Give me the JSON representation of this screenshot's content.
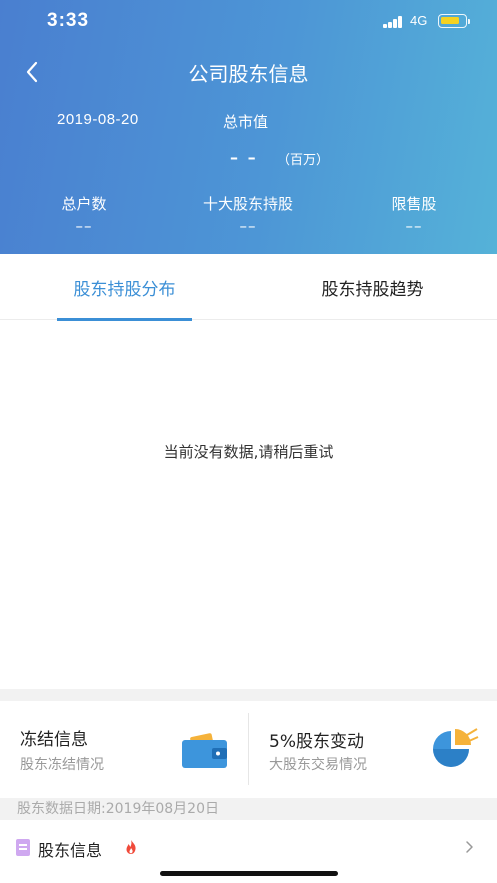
{
  "status_bar": {
    "time": "3:33",
    "network": "4G"
  },
  "header": {
    "title": "公司股东信息",
    "date": "2019-08-20",
    "market_cap_label": "总市值",
    "market_cap_value": "– –",
    "market_cap_unit": "（百万）",
    "stats": [
      {
        "label": "总户数",
        "value": "––"
      },
      {
        "label": "十大股东持股",
        "value": "––"
      },
      {
        "label": "限售股",
        "value": "––"
      }
    ]
  },
  "tabs": [
    {
      "label": "股东持股分布",
      "active": true
    },
    {
      "label": "股东持股趋势",
      "active": false
    }
  ],
  "empty_message": "当前没有数据,请稍后重试",
  "cards": [
    {
      "title": "冻结信息",
      "subtitle": "股东冻结情况",
      "icon": "wallet-icon"
    },
    {
      "title": "5%股东变动",
      "subtitle": "大股东交易情况",
      "icon": "pie-chart-icon"
    }
  ],
  "data_date": "股东数据日期:2019年08月20日",
  "shareholder_row": {
    "label": "股东信息",
    "icon": "document-icon",
    "badge_icon": "fire-icon"
  },
  "colors": {
    "header_start": "#4a7fd0",
    "header_end": "#55b2d8",
    "accent": "#3b8fd6",
    "fire": "#f04a3a"
  }
}
